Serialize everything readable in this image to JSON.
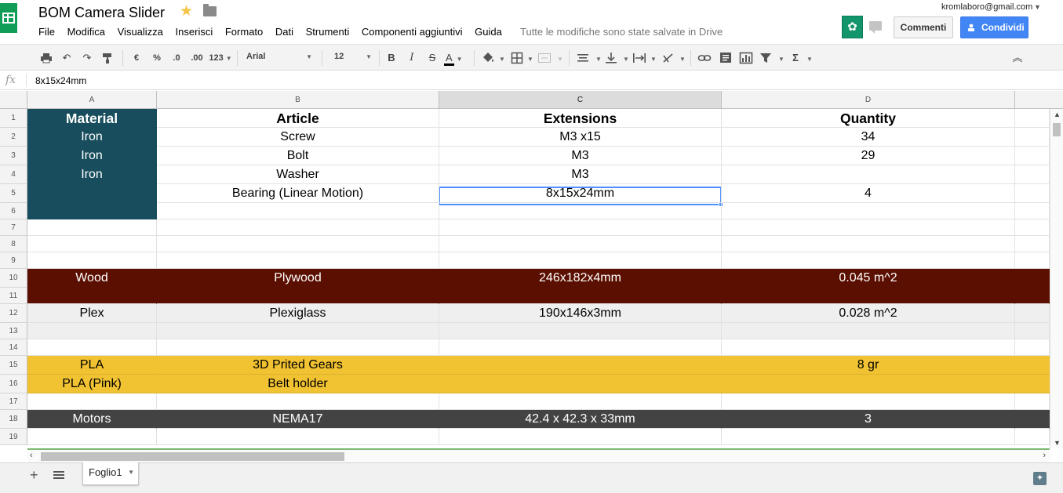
{
  "app": {
    "doc_title": "BOM Camera Slider",
    "save_status": "Tutte le modifiche sono state salvate in Drive",
    "account_email": "kromlaboro@gmail.com"
  },
  "menu": [
    "File",
    "Modifica",
    "Visualizza",
    "Inserisci",
    "Formato",
    "Dati",
    "Strumenti",
    "Componenti aggiuntivi",
    "Guida"
  ],
  "buttons": {
    "comments": "Commenti",
    "share": "Condividi"
  },
  "toolbar": {
    "currency": "€",
    "percent": "%",
    "decrease_decimals": ".0",
    "increase_decimals": ".00",
    "more_formats": "123",
    "font": "Arial",
    "font_size": "12",
    "bold": "B",
    "italic": "I",
    "strikethrough": "S",
    "text_color": "A",
    "sum": "Σ"
  },
  "formula_bar": {
    "fx": "fx",
    "value": "8x15x24mm"
  },
  "columns": [
    "A",
    "B",
    "C",
    "D"
  ],
  "selected_cell": "C5",
  "colors": {
    "teal": "#174d5c",
    "wood": "#5b0f00",
    "plex_gray": "#efefef",
    "pla_yellow": "#f1c232",
    "motors_dark": "#434343",
    "selection_blue": "#4d90fe",
    "share_blue": "#4285f4"
  },
  "rows": [
    {
      "num": "1",
      "cells": [
        "Material",
        "Article",
        "Extensions",
        "Quantity"
      ]
    },
    {
      "num": "2",
      "cells": [
        "Iron",
        "Screw",
        "M3 x15",
        "34"
      ]
    },
    {
      "num": "3",
      "cells": [
        "Iron",
        "Bolt",
        "M3",
        "29"
      ]
    },
    {
      "num": "4",
      "cells": [
        "Iron",
        "Washer",
        "M3",
        ""
      ]
    },
    {
      "num": "5",
      "cells": [
        "",
        "Bearing (Linear Motion)",
        "8x15x24mm",
        "4"
      ]
    },
    {
      "num": "6",
      "cells": [
        "",
        "",
        "",
        ""
      ]
    },
    {
      "num": "7",
      "cells": [
        "",
        "",
        "",
        ""
      ]
    },
    {
      "num": "8",
      "cells": [
        "",
        "",
        "",
        ""
      ]
    },
    {
      "num": "9",
      "cells": [
        "",
        "",
        "",
        ""
      ]
    },
    {
      "num": "10",
      "cells": [
        "Wood",
        "Plywood",
        "246x182x4mm",
        "0.045 m^2"
      ]
    },
    {
      "num": "11",
      "cells": [
        "",
        "",
        "",
        ""
      ]
    },
    {
      "num": "12",
      "cells": [
        "Plex",
        "Plexiglass",
        "190x146x3mm",
        "0.028 m^2"
      ]
    },
    {
      "num": "13",
      "cells": [
        "",
        "",
        "",
        ""
      ]
    },
    {
      "num": "14",
      "cells": [
        "",
        "",
        "",
        ""
      ]
    },
    {
      "num": "15",
      "cells": [
        "PLA",
        "3D Prited Gears",
        "",
        "8 gr"
      ]
    },
    {
      "num": "16",
      "cells": [
        "PLA (Pink)",
        "Belt holder",
        "",
        ""
      ]
    },
    {
      "num": "17",
      "cells": [
        "",
        "",
        "",
        ""
      ]
    },
    {
      "num": "18",
      "cells": [
        "Motors",
        "NEMA17",
        "42.4 x 42.3 x 33mm",
        "3"
      ]
    },
    {
      "num": "19",
      "cells": [
        "",
        "",
        "",
        ""
      ]
    }
  ],
  "sheet_tabs": [
    "Foglio1"
  ]
}
